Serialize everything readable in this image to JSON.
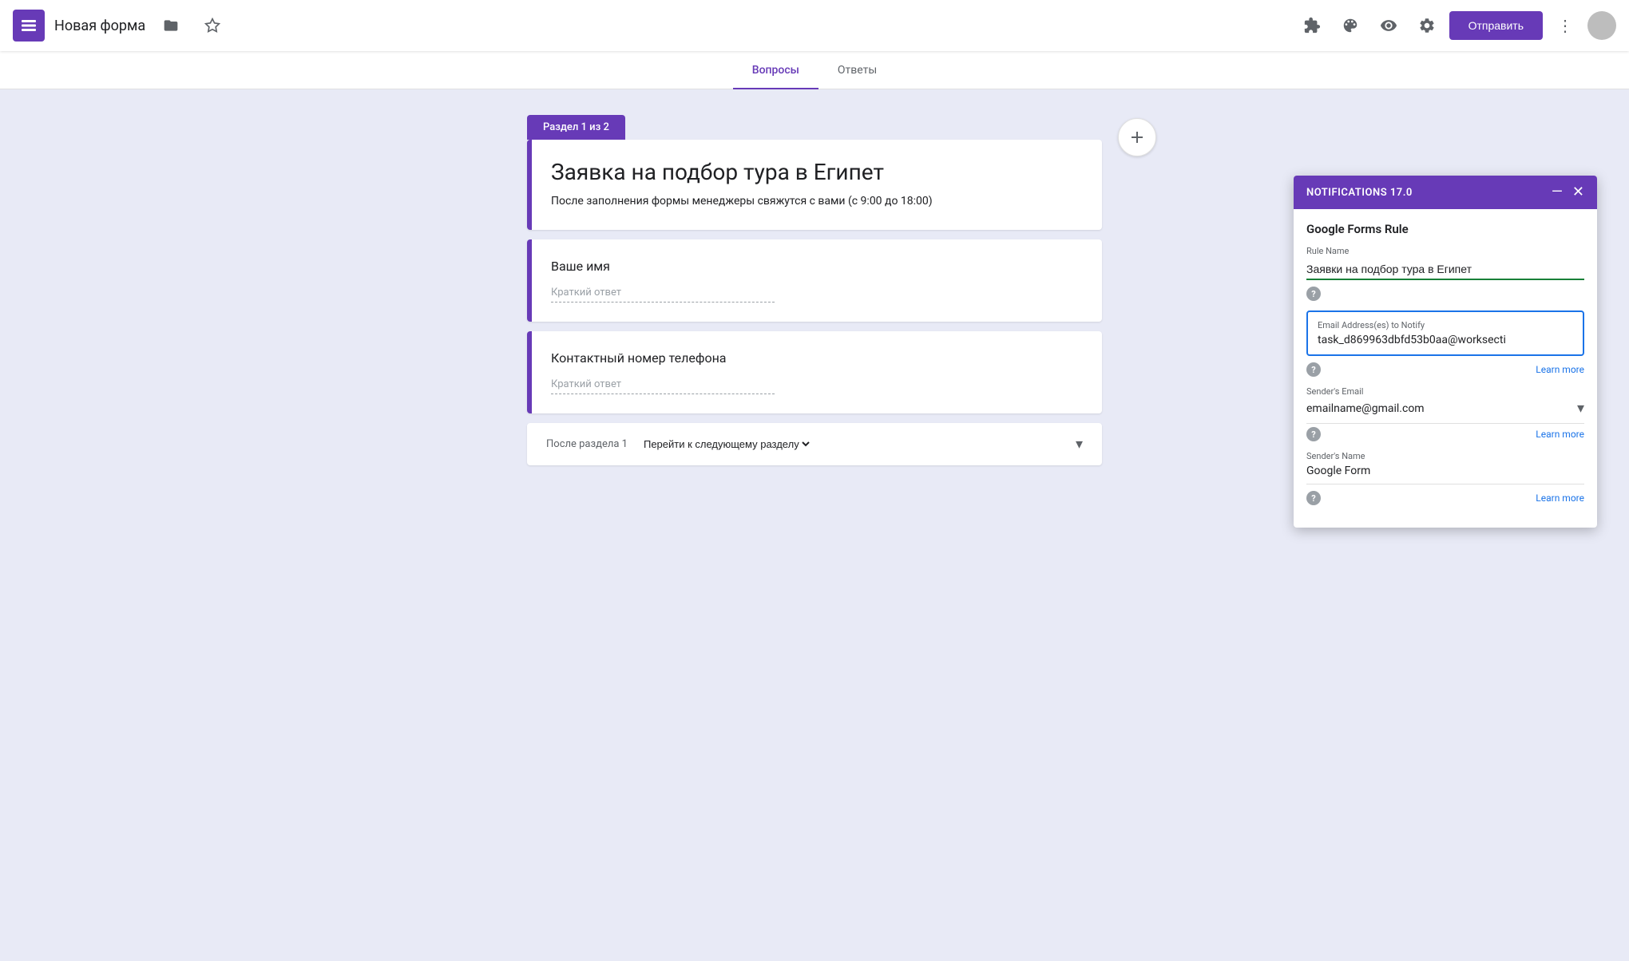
{
  "topbar": {
    "app_icon_label": "Google Forms",
    "form_title": "Новая форма",
    "send_button_label": "Отправить",
    "folder_icon": "📁",
    "star_icon": "☆",
    "palette_icon": "🎨",
    "eye_icon": "👁",
    "gear_icon": "⚙",
    "more_icon": "⋮"
  },
  "tabs": [
    {
      "id": "questions",
      "label": "Вопросы",
      "active": true
    },
    {
      "id": "answers",
      "label": "Ответы",
      "active": false
    }
  ],
  "section": {
    "label": "Раздел 1 из 2",
    "form_title": "Заявка на подбор тура в Египет",
    "form_description": "После заполнения формы менеджеры свяжутся с вами (с 9:00 до 18:00)"
  },
  "questions": [
    {
      "id": "q1",
      "label": "Ваше имя",
      "placeholder": "Краткий ответ"
    },
    {
      "id": "q2",
      "label": "Контактный номер телефона",
      "placeholder": "Краткий ответ"
    }
  ],
  "footer": {
    "prefix": "После раздела 1",
    "action": "Перейти к следующему разделу"
  },
  "notifications_panel": {
    "title": "NOTIFICATIONS 17.0",
    "minimize_label": "—",
    "close_label": "✕",
    "section_title": "Google Forms Rule",
    "rule_name_label": "Rule Name",
    "rule_name_value": "Заявки на подбор тура в Египет",
    "email_address_label": "Email Address(es) to Notify",
    "email_address_value": "task_d869963dbfd53b0aa@worksecti",
    "learn_more_1": "Learn more",
    "sender_email_label": "Sender's Email",
    "sender_email_value": "emailname@gmail.com",
    "learn_more_2": "Learn more",
    "sender_name_label": "Sender's Name",
    "sender_name_value": "Google Form",
    "learn_more_3": "Learn more"
  }
}
